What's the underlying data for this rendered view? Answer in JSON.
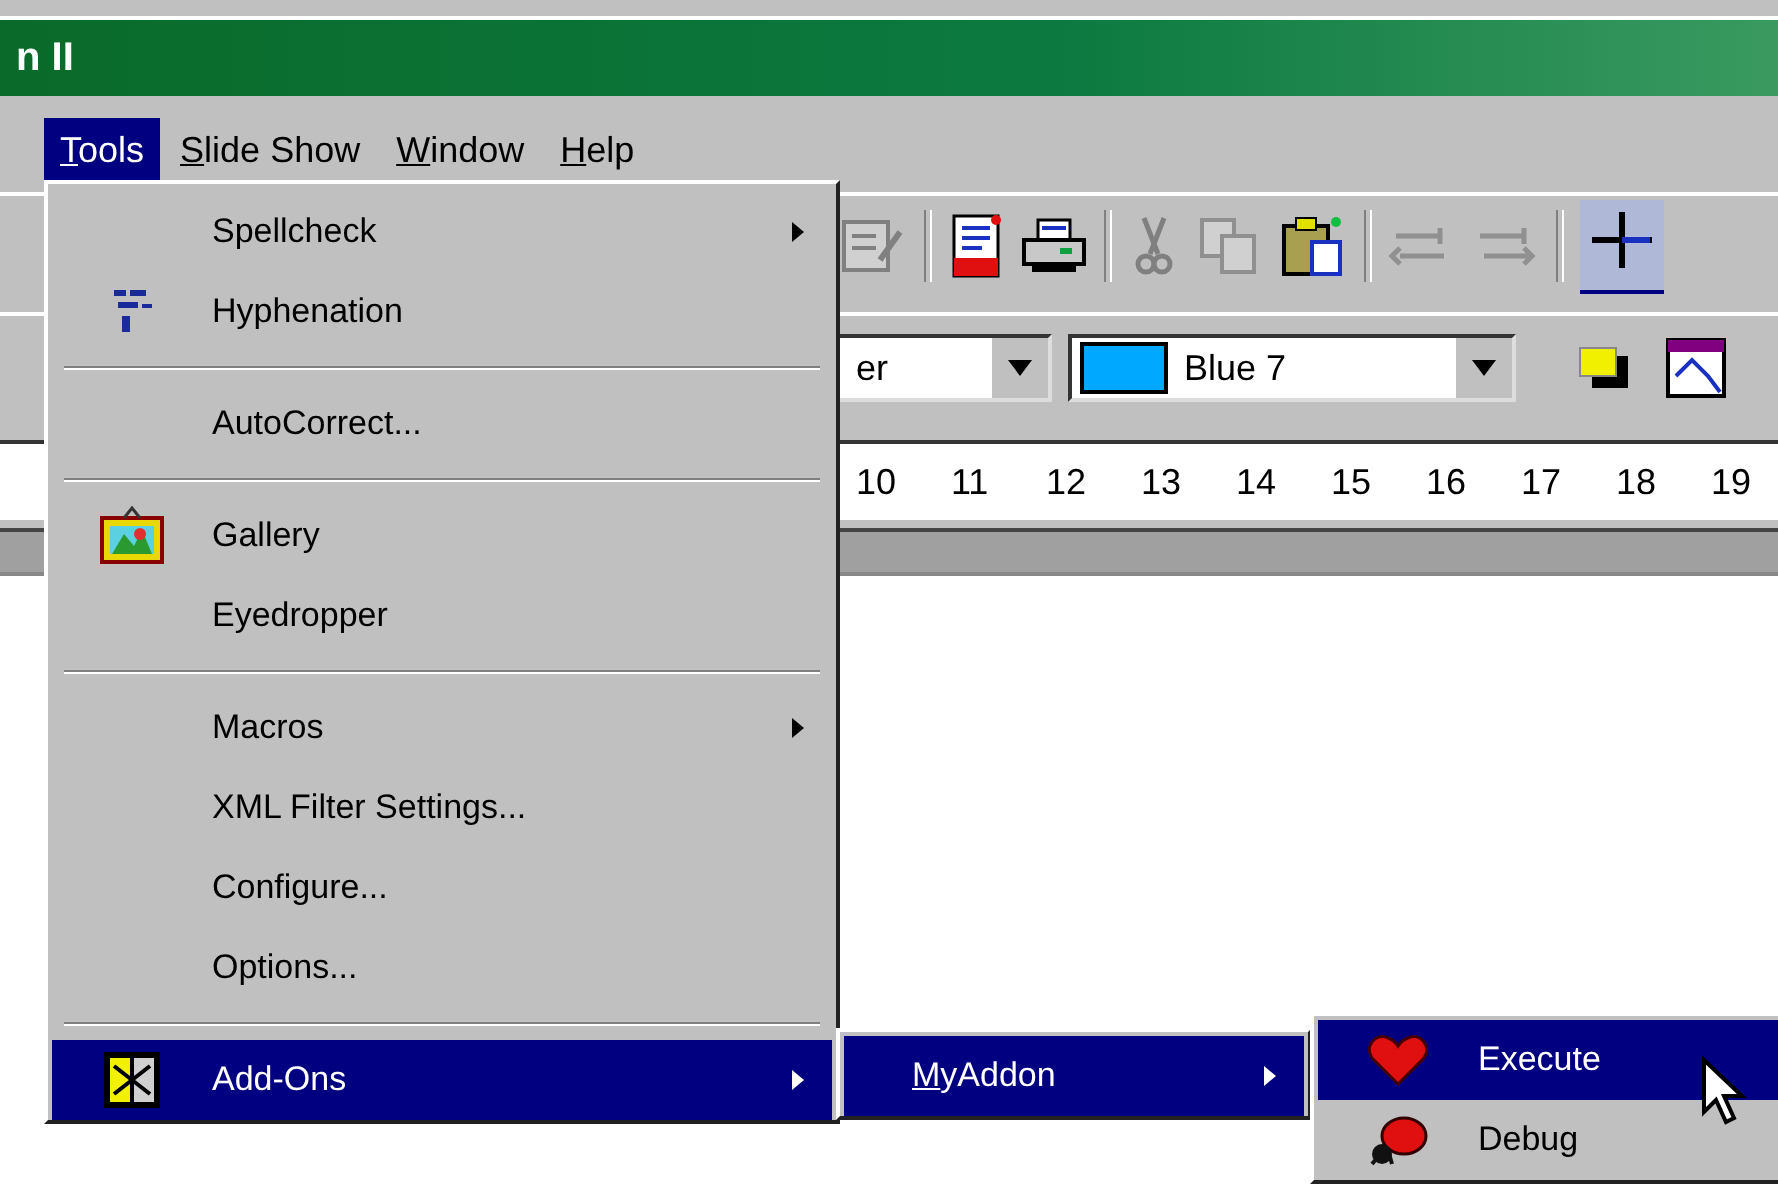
{
  "window": {
    "title": "n II"
  },
  "menubar": [
    {
      "label": "Tools",
      "selected": true
    },
    {
      "label": "Slide Show",
      "selected": false
    },
    {
      "label": "Window",
      "selected": false
    },
    {
      "label": "Help",
      "selected": false
    }
  ],
  "font_combo": {
    "value": "er"
  },
  "color_combo": {
    "value": "Blue 7"
  },
  "ruler": [
    "10",
    "11",
    "12",
    "13",
    "14",
    "15",
    "16",
    "17",
    "18",
    "19"
  ],
  "tools_menu": [
    {
      "kind": "item",
      "label": "Spellcheck",
      "submenu": true,
      "selected": false
    },
    {
      "kind": "item",
      "label": "Hyphenation",
      "submenu": false,
      "selected": false
    },
    {
      "kind": "separator"
    },
    {
      "kind": "item",
      "label": "AutoCorrect...",
      "submenu": false,
      "selected": false
    },
    {
      "kind": "separator"
    },
    {
      "kind": "item",
      "label": "Gallery",
      "submenu": false,
      "selected": false
    },
    {
      "kind": "item",
      "label": "Eyedropper",
      "submenu": false,
      "selected": false
    },
    {
      "kind": "separator"
    },
    {
      "kind": "item",
      "label": "Macros",
      "submenu": true,
      "selected": false
    },
    {
      "kind": "item",
      "label": "XML Filter Settings...",
      "submenu": false,
      "selected": false
    },
    {
      "kind": "item",
      "label": "Configure...",
      "submenu": false,
      "selected": false
    },
    {
      "kind": "item",
      "label": "Options...",
      "submenu": false,
      "selected": false
    },
    {
      "kind": "separator"
    },
    {
      "kind": "item",
      "label": "Add-Ons",
      "submenu": true,
      "selected": true
    }
  ],
  "addons_menu": [
    {
      "label": "MyAddon",
      "submenu": true,
      "selected": true
    }
  ],
  "myaddon_menu": [
    {
      "label": "Execute",
      "selected": true
    },
    {
      "label": "Debug",
      "selected": false
    }
  ]
}
